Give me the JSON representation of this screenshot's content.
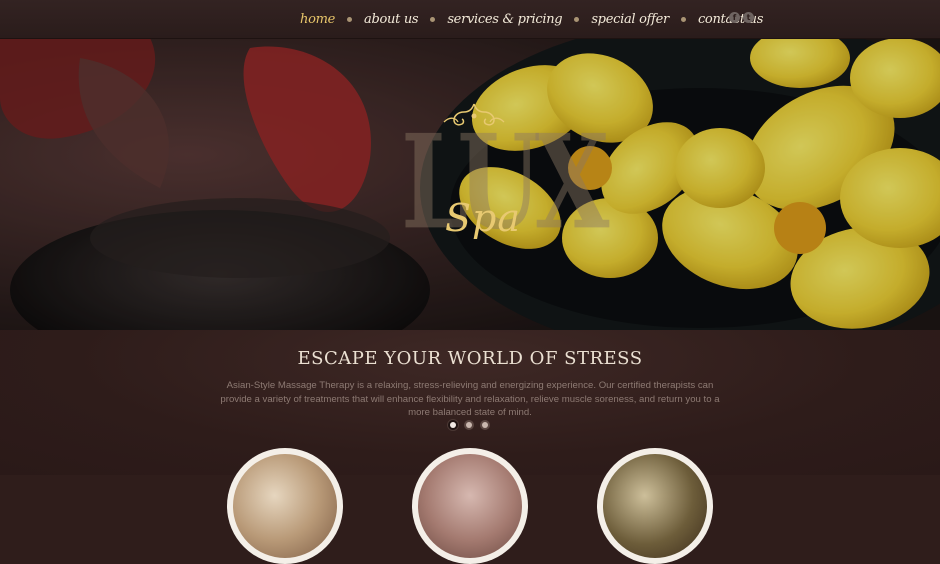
{
  "nav": {
    "items": [
      {
        "label": "home",
        "active": true
      },
      {
        "label": "about us",
        "active": false
      },
      {
        "label": "services & pricing",
        "active": false
      },
      {
        "label": "special offer",
        "active": false
      },
      {
        "label": "contact us",
        "active": false
      }
    ],
    "social": [
      {
        "icon": "facebook-icon",
        "glyph": "f"
      },
      {
        "icon": "twitter-icon",
        "glyph": "t"
      }
    ]
  },
  "hero": {
    "logo_big": "LUX",
    "logo_script": "Spa"
  },
  "main": {
    "headline": "ESCAPE YOUR WORLD OF STRESS",
    "paragraph": "Asian-Style Massage Therapy is a relaxing, stress-relieving and energizing experience. Our certified therapists can provide a variety of treatments that will enhance flexibility and relaxation, relieve muscle soreness, and return you to a more balanced state of mind.",
    "slider_dots": 3,
    "active_dot": 0
  },
  "colors": {
    "accent": "#e8c971",
    "background": "#2f1d1b",
    "text": "#ebe0d2"
  }
}
